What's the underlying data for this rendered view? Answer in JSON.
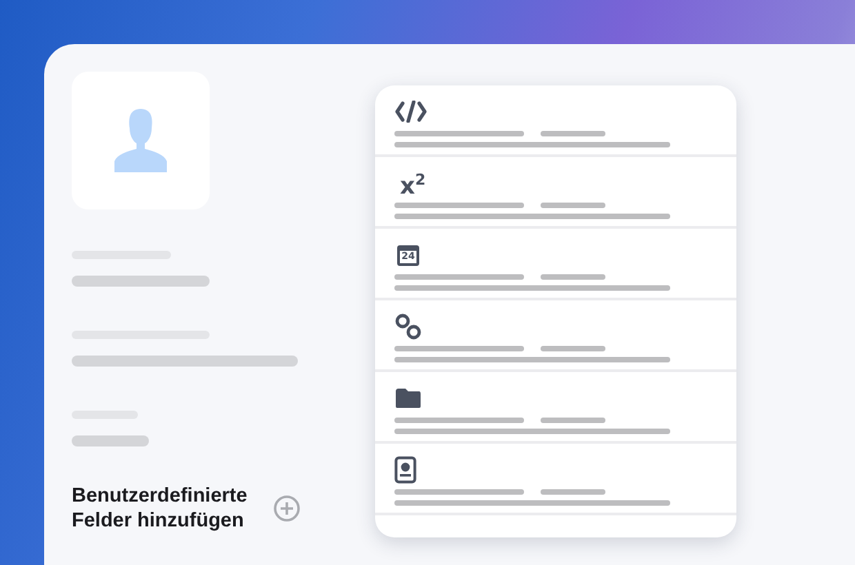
{
  "fields": [
    {
      "kind": "code"
    },
    {
      "kind": "superscript",
      "label": "x$^{2}$"
    },
    {
      "kind": "calendar",
      "label": "24"
    },
    {
      "kind": "link"
    },
    {
      "kind": "folder"
    },
    {
      "kind": "id"
    }
  ],
  "add_fields": {
    "label": "Benutzerdefinierte Felder hinzufügen"
  }
}
